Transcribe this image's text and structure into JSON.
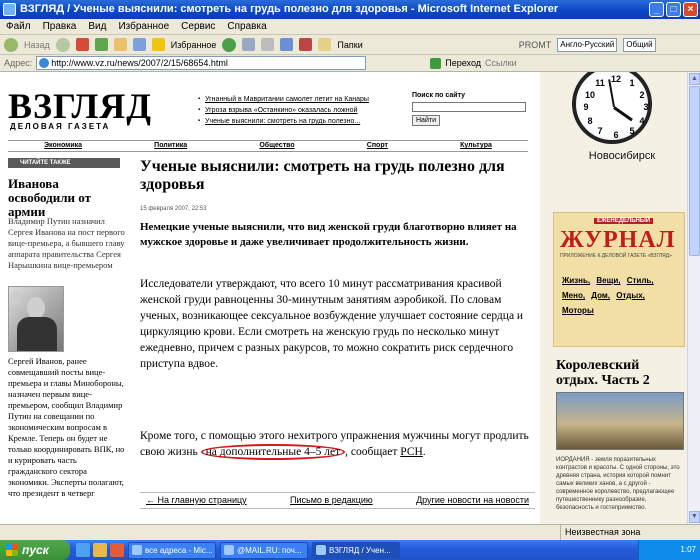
{
  "window": {
    "title": "ВЗГЛЯД / Ученые выяснили: смотреть на грудь полезно для здоровья - Microsoft Internet Explorer"
  },
  "menu": [
    "Файл",
    "Правка",
    "Вид",
    "Избранное",
    "Сервис",
    "Справка"
  ],
  "toolbar": {
    "back": "Назад",
    "favorites": "Избранное",
    "folders": "Папки",
    "promt": "PROMT",
    "lang": "Англо-Русский",
    "style": "Общий"
  },
  "address": {
    "label": "Адрес:",
    "url": "http://www.vz.ru/news/2007/2/15/68654.html",
    "go": "Переход",
    "links": "Ссылки"
  },
  "site": {
    "logo": "ВЗГЛЯД",
    "logo_sub": "ДЕЛОВАЯ ГАЗЕТА",
    "headlines": [
      "Угнанный в Мавритании самолет летит на Канары",
      "Угроза взрыва «Останкино» оказалась ложной",
      "Ученые выяснили: смотреть на грудь полезно..."
    ],
    "search_label": "Поиск по сайту",
    "search_button": "Найти",
    "nav": [
      "Экономика",
      "Политика",
      "Общество",
      "Спорт",
      "Культура"
    ]
  },
  "left": {
    "read_also": "ЧИТАЙТЕ ТАКЖЕ",
    "headline": "Иванова освободили от армии",
    "lead": "Владимир Путин назначил Сергея Иванова на пост первого вице-премьера, а бывшего главу аппарата правительства Сергея Нарышкина вице-премьером",
    "body": "Сергей Иванов, ранее совмещавший посты вице-премьера и главы Минобороны, назначен первым вице-премьером, сообщил Владимир Путин на совещании по экономическим вопросам в Кремле. Теперь он будет не только координировать ВПК, но и курировать часть гражданского сектора экономики. Эксперты полагают, что президент в четверг"
  },
  "article": {
    "title": "Ученые выяснили: смотреть на грудь полезно для здоровья",
    "date": "15 февраля 2007, 22:53",
    "lead": "Немецкие ученые выяснили, что вид женской груди благотворно влияет на мужское здоровье и даже увеличивает продолжительность жизни.",
    "p1": "Исследователи утверждают, что всего 10 минут рассматривания красивой женской груди равноценны 30-минутным занятиям аэробикой. По словам ученых, возникающее сексуальное возбуждение улучшает состояние сердца и циркуляцию крови. Если смотреть на женскую грудь по несколько минут ежедневно, причем с разных ракурсов, то можно сократить риск сердечного приступа вдвое.",
    "p2_start": "Кроме того, с помощью этого нехитрого упражнения мужчины могут продлить свою жизнь",
    "p2_circled": "на дополнительные 4–5 лет",
    "p2_end": ", сообщает",
    "p2_source": "РСН",
    "p2_tail": ".",
    "links": [
      "← На главную страницу",
      "Письмо в редакцию",
      "Другие новости на новости"
    ]
  },
  "right": {
    "clock_numbers": [
      "12",
      "1",
      "2",
      "3",
      "4",
      "5",
      "6",
      "7",
      "8",
      "9",
      "10",
      "11"
    ],
    "city": "Новосибирск",
    "mag_tag": "ЕЖЕНЕДЕЛЬНЫЙ",
    "mag_title": "ЖУРНАЛ",
    "mag_sub": "ПРИЛОЖЕНИЕ К ДЕЛОВОЙ ГАЗЕТЕ «ВЗГЛЯД»",
    "mag_links": [
      "Жизнь,",
      "Вещи,",
      "Стиль,",
      "Мено,",
      "Дом,",
      "Отдых,",
      "Моторы"
    ],
    "royal_title": "Королевский отдых. Часть 2",
    "royal_text": "ИОРДАНИЯ - земля поразительных контрастов и красоты. С одной стороны, это древняя страна, история которой помнит самых великих ханов, а с другой - современное королевство, предлагающее путешественнику разнообразие, безопасность и гостеприимство."
  },
  "status": {
    "zone": "Неизвестная зона"
  },
  "taskbar": {
    "start": "пуск",
    "tasks": [
      "все адреса - Mic...",
      "@MAIL.RU: поч...",
      "ВЗГЛЯД / Учен..."
    ],
    "time": "1:07"
  }
}
